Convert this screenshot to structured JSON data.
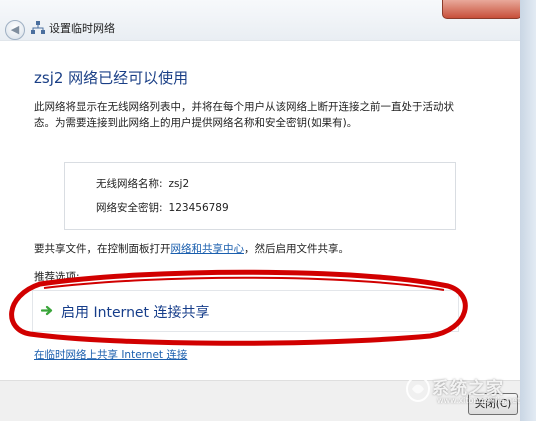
{
  "window": {
    "title": "设置临时网络"
  },
  "main": {
    "headline": "zsj2 网络已经可以使用",
    "description": "此网络将显示在无线网络列表中，并将在每个用户从该网络上断开连接之前一直处于活动状态。为需要连接到此网络上的用户提供网络名称和安全密钥(如果有)。",
    "network_name_label": "无线网络名称:",
    "network_name_value": "zsj2",
    "security_key_label": "网络安全密钥:",
    "security_key_value": "123456789",
    "share_prefix": "要共享文件，在控制面板打开",
    "share_link": "网络和共享中心",
    "share_suffix": "，然后启用文件共享。",
    "recommended_label": "推荐选项:",
    "option_label": "启用 Internet 连接共享",
    "bottom_link": "在临时网络上共享 Internet 连接"
  },
  "footer": {
    "close_label": "关闭(C)"
  },
  "watermark": {
    "text": "系统之家",
    "url": "www.xitongzhijia.net"
  },
  "colors": {
    "headline": "#1a3f86",
    "link": "#1b5fae",
    "annotation_ring": "#d10000",
    "option_arrow": "#3aa53a"
  }
}
